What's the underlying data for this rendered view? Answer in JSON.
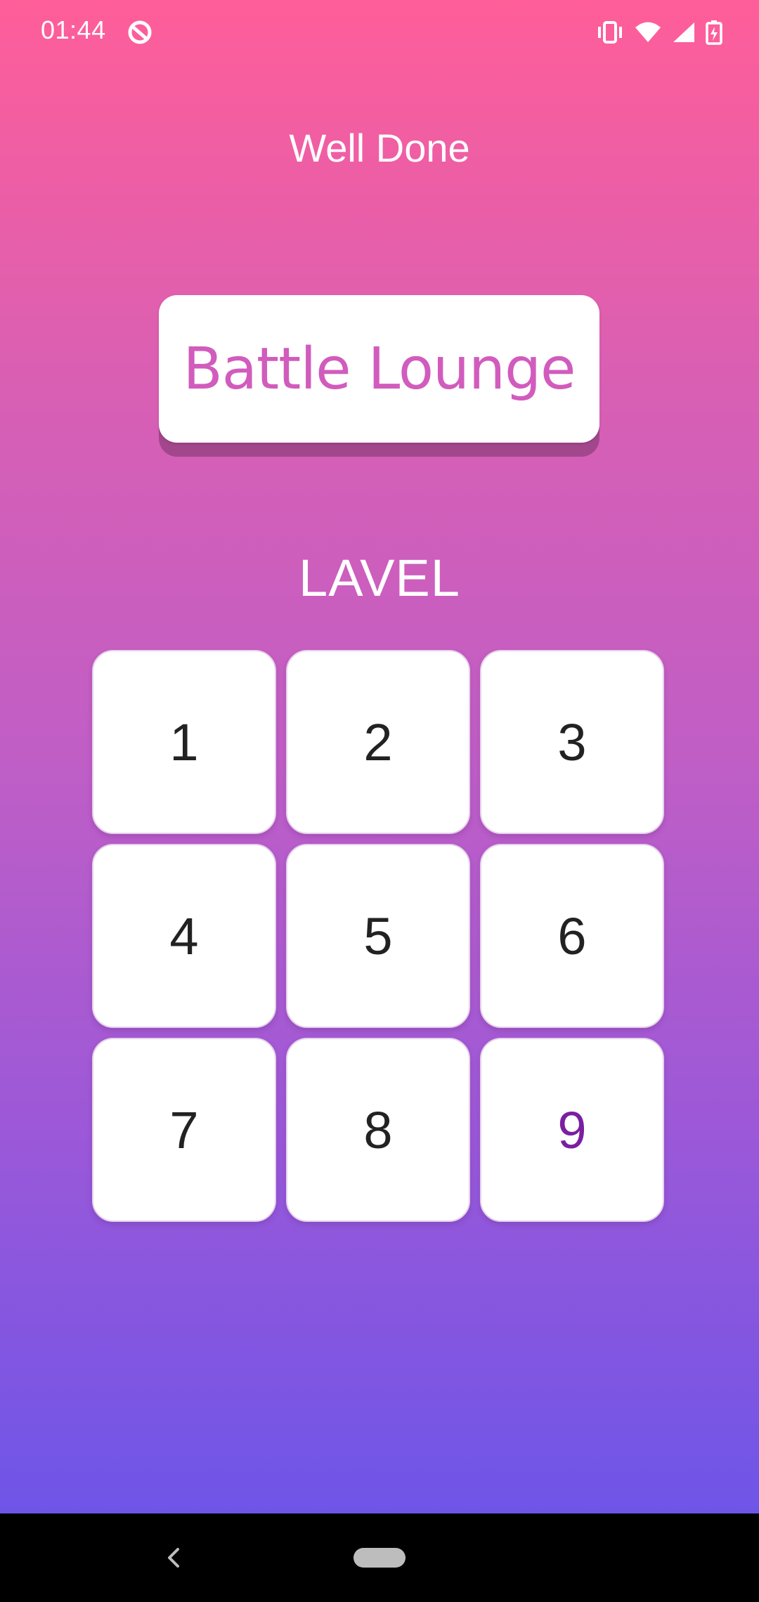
{
  "status_bar": {
    "time": "01:44",
    "left_icon": "sync-ring-icon",
    "right_icons": [
      "vibrate-icon",
      "wifi-icon",
      "signal-icon",
      "battery-charging-icon"
    ]
  },
  "header": {
    "title": "Well Done"
  },
  "battle_button": {
    "label": "Battle Lounge"
  },
  "level_section": {
    "title": "LAVEL",
    "levels": [
      {
        "label": "1",
        "current": false
      },
      {
        "label": "2",
        "current": false
      },
      {
        "label": "3",
        "current": false
      },
      {
        "label": "4",
        "current": false
      },
      {
        "label": "5",
        "current": false
      },
      {
        "label": "6",
        "current": false
      },
      {
        "label": "7",
        "current": false
      },
      {
        "label": "8",
        "current": false
      },
      {
        "label": "9",
        "current": true
      }
    ]
  },
  "nav_bar": {
    "back_icon": "back-chevron-icon",
    "home_icon": "home-pill-icon"
  },
  "colors": {
    "gradient_top": "#ff5e99",
    "gradient_bottom": "#6e55e8",
    "battle_label": "#d15cbd",
    "current_level": "#7a1fa2"
  }
}
